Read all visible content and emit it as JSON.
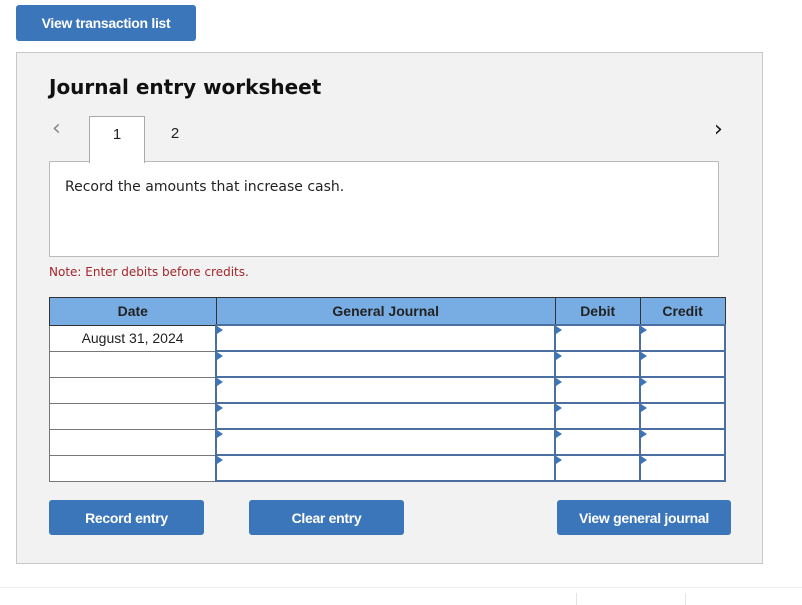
{
  "top": {
    "view_transactions_label": "View transaction list"
  },
  "worksheet": {
    "title": "Journal entry worksheet",
    "tabs": [
      {
        "label": "1",
        "active": true
      },
      {
        "label": "2",
        "active": false
      }
    ],
    "prev_icon": "chevron-left-icon",
    "next_icon": "chevron-right-icon",
    "instruction": "Record the amounts that increase cash.",
    "note": "Note: Enter debits before credits.",
    "table": {
      "headers": [
        "Date",
        "General Journal",
        "Debit",
        "Credit"
      ],
      "rows": [
        {
          "date": "August 31, 2024",
          "account": "",
          "debit": "",
          "credit": ""
        },
        {
          "date": "",
          "account": "",
          "debit": "",
          "credit": ""
        },
        {
          "date": "",
          "account": "",
          "debit": "",
          "credit": ""
        },
        {
          "date": "",
          "account": "",
          "debit": "",
          "credit": ""
        },
        {
          "date": "",
          "account": "",
          "debit": "",
          "credit": ""
        },
        {
          "date": "",
          "account": "",
          "debit": "",
          "credit": ""
        }
      ]
    },
    "buttons": {
      "record": "Record entry",
      "clear": "Clear entry",
      "view_journal": "View general journal"
    }
  },
  "colors": {
    "button": "#3b76bb",
    "header": "#78ade3",
    "note": "#a3262b"
  }
}
